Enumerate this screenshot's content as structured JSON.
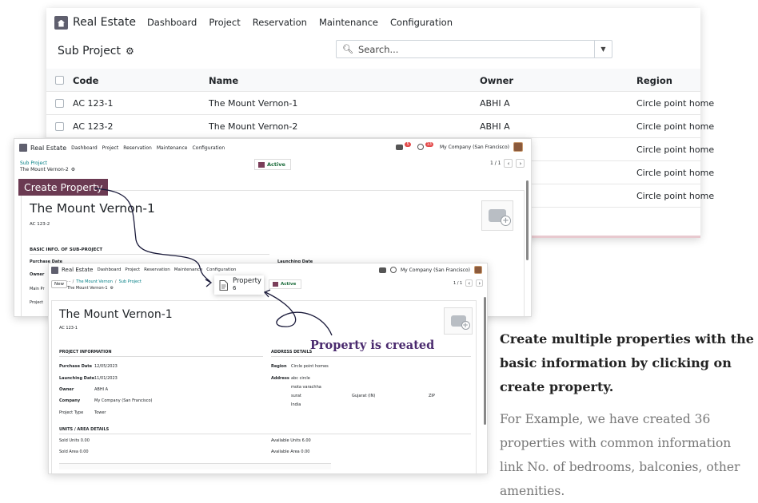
{
  "app_name": "Real Estate",
  "menu": [
    "Dashboard",
    "Project",
    "Reservation",
    "Maintenance",
    "Configuration"
  ],
  "list_view": {
    "title": "Sub Project",
    "search_placeholder": "Search...",
    "columns": [
      "Code",
      "Name",
      "Owner",
      "Region"
    ],
    "rows": [
      {
        "code": "AC 123-1",
        "name": "The Mount Vernon-1",
        "owner": "ABHI A",
        "region": "Circle point home"
      },
      {
        "code": "AC 123-2",
        "name": "The Mount Vernon-2",
        "owner": "ABHI A",
        "region": "Circle point home"
      },
      {
        "region": "Circle point home"
      },
      {
        "region": "Circle point home"
      },
      {
        "region": "Circle point home"
      }
    ]
  },
  "form1": {
    "breadcrumb": "Sub Project",
    "record": "The Mount Vernon-2",
    "status": "Active",
    "pager": "1 / 1",
    "company": "My Company (San Francisco)",
    "chat_badge": "5",
    "activity_badge": "13",
    "title": "The Mount Vernon-1",
    "code": "AC 123-2",
    "section_basic": "BASIC INFO. OF SUB-PROJECT",
    "purchase_label": "Purchase Date",
    "launching_label": "Launching Date",
    "owner_label": "Owner",
    "main_label": "Main Pr",
    "project_label": "Project"
  },
  "callout_create": "Create Property",
  "form2": {
    "new_btn": "New",
    "breadcrumb_1": "The Mount Vernon",
    "breadcrumb_2": "Sub Project",
    "record": "The Mount Vernon-1",
    "smart_label": "Property",
    "smart_count": "6",
    "status": "Active",
    "pager": "1 / 1",
    "company": "My Company (San Francisco)",
    "title": "The Mount Vernon-1",
    "code": "AC 123-1",
    "section_project": "PROJECT INFORMATION",
    "section_address": "ADDRESS DETAILS",
    "section_units": "UNITS / AREA DETAILS",
    "fields": [
      {
        "label": "Purchase Date",
        "value": "12/05/2023"
      },
      {
        "label": "Launching Date",
        "value": "11/01/2023"
      },
      {
        "label": "Owner",
        "value": "ABHI A"
      },
      {
        "label": "Company",
        "value": "My Company (San Francisco)"
      },
      {
        "label": "Project Type",
        "value": "Tower"
      }
    ],
    "region_label": "Region",
    "region_value": "Circle point homes",
    "address_label": "Address",
    "address_lines": [
      "abc circle",
      "mota varachha",
      "surat",
      "India"
    ],
    "state": "Gujarat (IN)",
    "zip": "ZIP",
    "sold_units": "Sold Units  0.00",
    "sold_area": "Sold Area  0.00",
    "available_units": "Available Units  6.00",
    "available_area": "Available Area  0.00"
  },
  "annotation": "Property is created",
  "text": {
    "heading": "Create multiple properties with the basic information by clicking on create property.",
    "body": "For Example, we have created 36 properties with common information link No. of bedrooms, balconies, other  amenities."
  }
}
